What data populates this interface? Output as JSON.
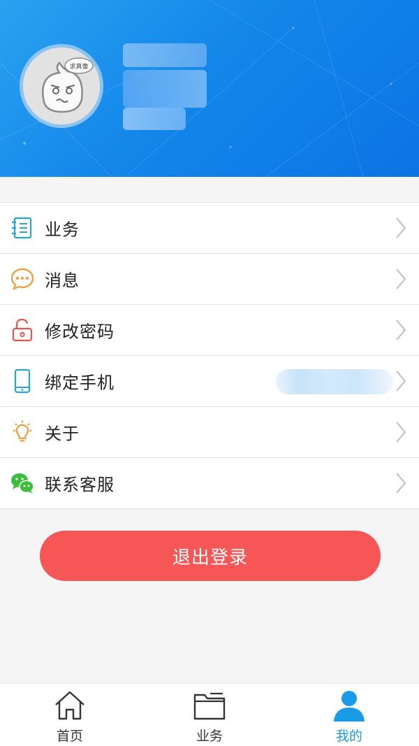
{
  "profile": {
    "avatar_bubble_text": "求真像"
  },
  "menu": {
    "items": [
      {
        "key": "business",
        "label": "业务",
        "icon": "notebook-icon",
        "color": "#27a6c9"
      },
      {
        "key": "messages",
        "label": "消息",
        "icon": "chat-bubble-icon",
        "color": "#f39a3a"
      },
      {
        "key": "password",
        "label": "修改密码",
        "icon": "unlock-icon",
        "color": "#e8534a"
      },
      {
        "key": "bind_phone",
        "label": "绑定手机",
        "icon": "phone-icon",
        "color": "#2aa1e0"
      },
      {
        "key": "about",
        "label": "关于",
        "icon": "lightbulb-icon",
        "color": "#f39a3a"
      },
      {
        "key": "support",
        "label": "联系客服",
        "icon": "wechat-icon",
        "color": "#3dbd3d"
      }
    ]
  },
  "logout": {
    "label": "退出登录",
    "color": "#f65656"
  },
  "tabbar": {
    "tabs": [
      {
        "label": "首页",
        "icon": "home-icon",
        "active": false
      },
      {
        "label": "业务",
        "icon": "folder-icon",
        "active": false
      },
      {
        "label": "我的",
        "icon": "user-icon",
        "active": true
      }
    ],
    "active_color": "#1a9be8"
  }
}
